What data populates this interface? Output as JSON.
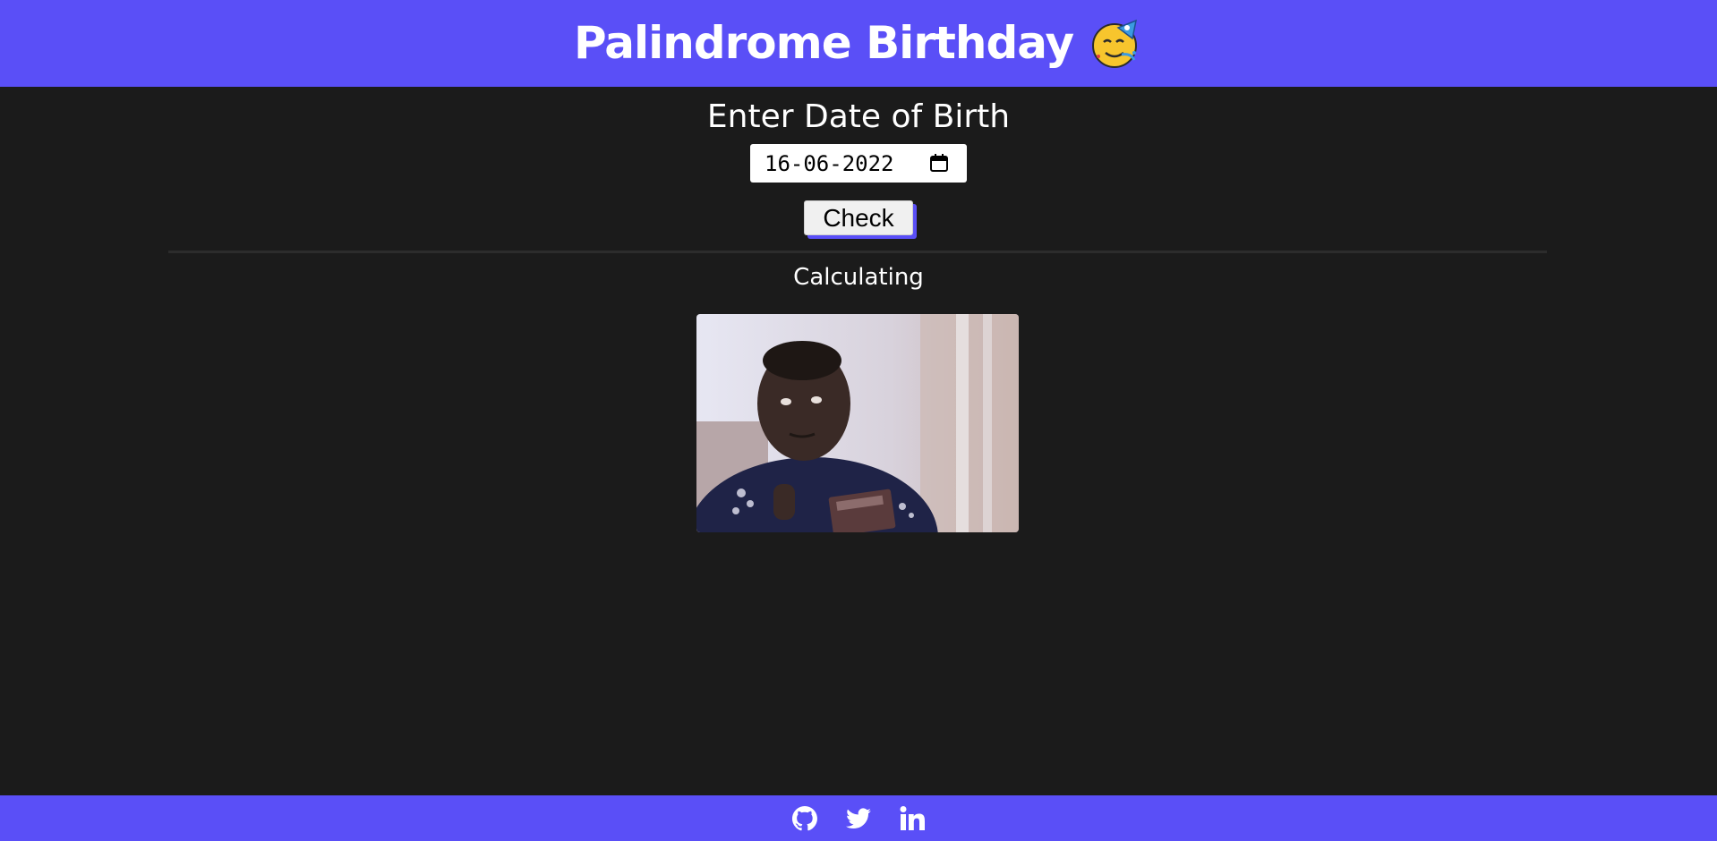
{
  "header": {
    "title": "Palindrome Birthday",
    "emoji_icon": "party-face-icon",
    "background": "#5a4ff7"
  },
  "form": {
    "label": "Enter Date of Birth",
    "date_value": "16-06-2022",
    "calendar_icon": "calendar-icon",
    "check_label": "Check"
  },
  "result": {
    "status": "Calculating",
    "gif_icon": "calculating-kid-gif"
  },
  "footer": {
    "links": [
      "github-icon",
      "twitter-icon",
      "linkedin-icon"
    ]
  },
  "colors": {
    "accent": "#5a4ff7",
    "background": "#1b1b1b",
    "text": "#ffffff"
  }
}
